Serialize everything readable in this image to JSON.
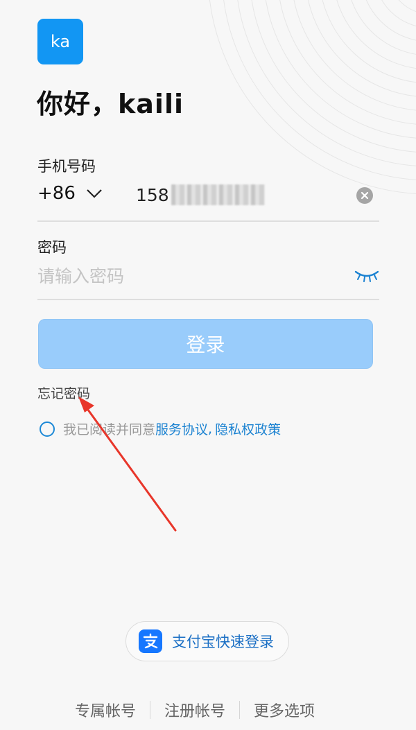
{
  "avatar": {
    "initials": "ka",
    "color": "#1296f3"
  },
  "greeting": "你好，kaili",
  "phone": {
    "label": "手机号码",
    "country_code": "+86",
    "value_visible": "158",
    "clear_icon": "clear-circle-icon"
  },
  "password": {
    "label": "密码",
    "placeholder": "请输入密码",
    "toggle_icon": "eye-closed-icon"
  },
  "login_button": "登录",
  "forgot_password": "忘记密码",
  "agreement": {
    "prefix": "我已阅读并同意",
    "service_link": "服务协议",
    "separator": ",",
    "privacy_link": "隐私权政策"
  },
  "alipay_login": {
    "label": "支付宝快速登录",
    "icon": "alipay-icon"
  },
  "bottom_links": [
    "专属帐号",
    "注册帐号",
    "更多选项"
  ],
  "colors": {
    "accent": "#1296f3",
    "link": "#1b82d1",
    "login_disabled": "#99ccfb",
    "annotation_arrow": "#e8362a"
  }
}
